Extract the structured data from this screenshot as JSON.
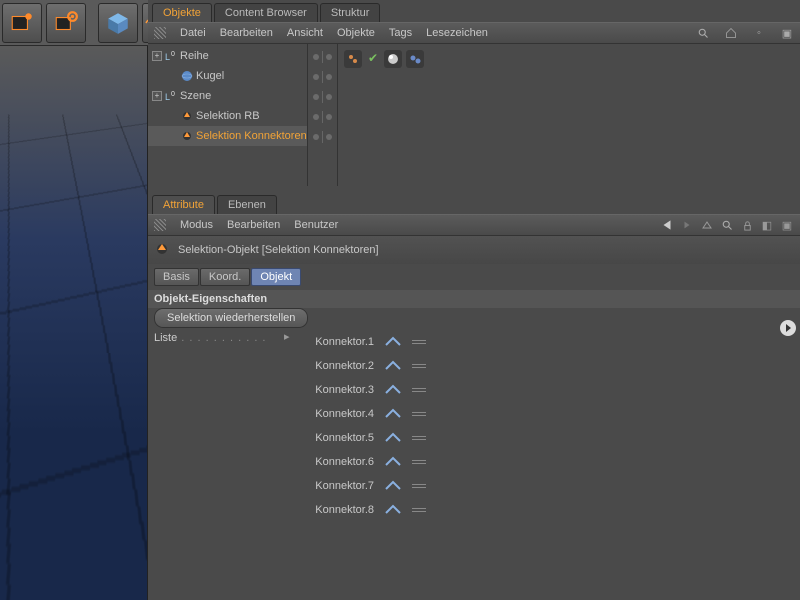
{
  "toolbar": {
    "icons": [
      "render",
      "render-settings",
      "cube",
      "deformer"
    ]
  },
  "objManager": {
    "tabs": [
      "Objekte",
      "Content Browser",
      "Struktur"
    ],
    "activeTab": 0,
    "menu": [
      "Datei",
      "Bearbeiten",
      "Ansicht",
      "Objekte",
      "Tags",
      "Lesezeichen"
    ],
    "tree": [
      {
        "label": "Reihe",
        "depth": 0,
        "expander": "+",
        "icon": "L0",
        "selected": false
      },
      {
        "label": "Kugel",
        "depth": 1,
        "expander": "",
        "icon": "sphere",
        "selected": false
      },
      {
        "label": "Szene",
        "depth": 0,
        "expander": "+",
        "icon": "L0",
        "selected": false
      },
      {
        "label": "Selektion RB",
        "depth": 1,
        "expander": "",
        "icon": "sel",
        "selected": false
      },
      {
        "label": "Selektion Konnektoren",
        "depth": 1,
        "expander": "",
        "icon": "sel",
        "selected": true
      }
    ]
  },
  "attrManager": {
    "tabs": [
      "Attribute",
      "Ebenen"
    ],
    "activeTab": 0,
    "menu": [
      "Modus",
      "Bearbeiten",
      "Benutzer"
    ],
    "objectTitle": "Selektion-Objekt [Selektion Konnektoren]",
    "subtabs": [
      "Basis",
      "Koord.",
      "Objekt"
    ],
    "activeSubtab": 2,
    "sectionTitle": "Objekt-Eigenschaften",
    "restoreBtn": "Selektion wiederherstellen",
    "listLabel": "Liste",
    "list": [
      "Konnektor.1",
      "Konnektor.2",
      "Konnektor.3",
      "Konnektor.4",
      "Konnektor.5",
      "Konnektor.6",
      "Konnektor.7",
      "Konnektor.8"
    ]
  }
}
